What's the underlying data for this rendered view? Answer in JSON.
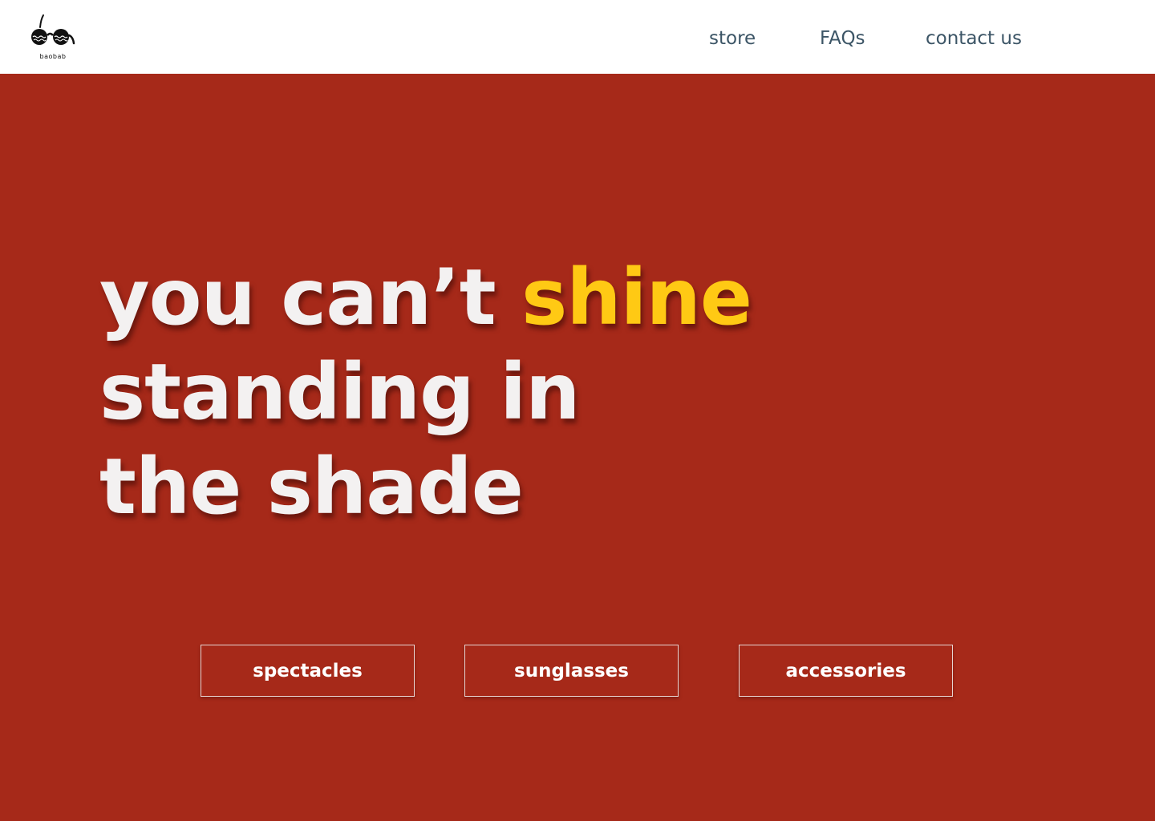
{
  "brand": {
    "name": "baobab",
    "icon": "sunglasses-logo-icon"
  },
  "nav": {
    "items": [
      {
        "label": "store"
      },
      {
        "label": "FAQs"
      },
      {
        "label": "contact us"
      }
    ]
  },
  "hero": {
    "headline": {
      "part1": "you can’t ",
      "accent": "shine",
      "line2": "standing in",
      "line3": "the shade"
    },
    "buttons": [
      {
        "label": "spectacles"
      },
      {
        "label": "sunglasses"
      },
      {
        "label": "accessories"
      }
    ]
  },
  "colors": {
    "background_hero": "#a62919",
    "accent": "#ffc914",
    "headline_text": "#f3f1f1",
    "nav_text": "#3c5566",
    "header_bg": "#ffffff"
  }
}
